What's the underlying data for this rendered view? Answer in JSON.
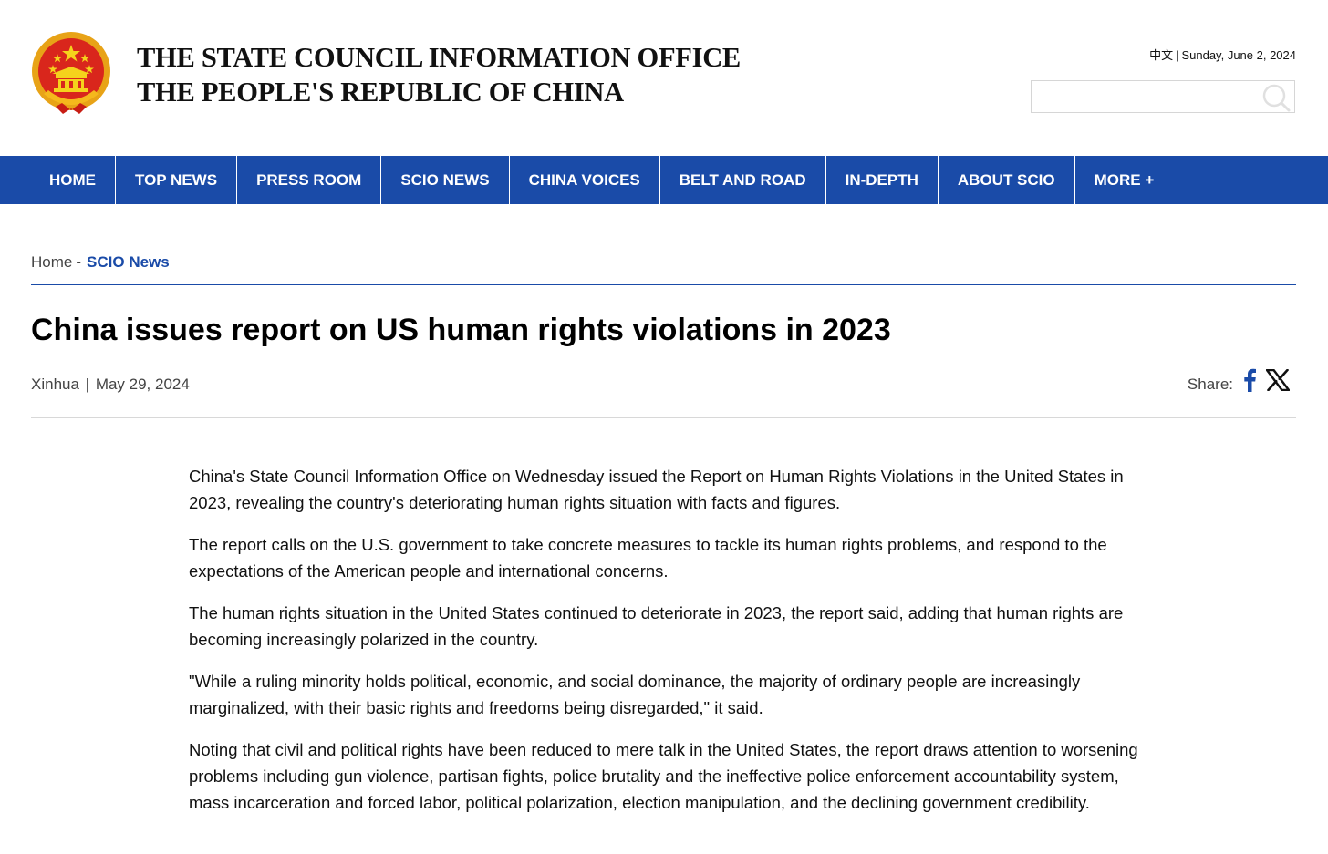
{
  "header": {
    "title_line1": "THE STATE COUNCIL INFORMATION OFFICE",
    "title_line2": "THE PEOPLE'S REPUBLIC OF CHINA",
    "language_link": "中文",
    "date": "Sunday, June 2, 2024",
    "search_placeholder": "",
    "emblem_icon": "national-emblem-icon",
    "search_icon": "magnifier-icon"
  },
  "nav": {
    "items": [
      {
        "label": "HOME"
      },
      {
        "label": "TOP NEWS"
      },
      {
        "label": "PRESS ROOM"
      },
      {
        "label": "SCIO NEWS"
      },
      {
        "label": "CHINA VOICES"
      },
      {
        "label": "BELT AND ROAD"
      },
      {
        "label": "IN-DEPTH"
      },
      {
        "label": "ABOUT SCIO"
      },
      {
        "label": "MORE +"
      }
    ]
  },
  "breadcrumb": {
    "home": "Home",
    "separator": "-",
    "current": "SCIO News"
  },
  "article": {
    "headline": "China issues report on US human rights violations in 2023",
    "source": "Xinhua",
    "date": "May 29, 2024",
    "share_label": "Share:",
    "paragraphs": [
      "China's State Council Information Office on Wednesday issued the Report on Human Rights Violations in the United States in 2023, revealing the country's deteriorating human rights situation with facts and figures.",
      "The report calls on the U.S. government to take concrete measures to tackle its human rights problems, and respond to the expectations of the American people and international concerns.",
      "The human rights situation in the United States continued to deteriorate in 2023, the report said, adding that human rights are becoming increasingly polarized in the country.",
      "\"While a ruling minority holds political, economic, and social dominance, the majority of ordinary people are increasingly marginalized, with their basic rights and freedoms being disregarded,\" it said.",
      "Noting that civil and political rights have been reduced to mere talk in the United States, the report draws attention to worsening problems including gun violence, partisan fights, police brutality and the ineffective police enforcement accountability system, mass incarceration and forced labor, political polarization, election manipulation, and the declining government credibility."
    ]
  },
  "colors": {
    "brand_blue": "#1a4ba8",
    "emblem_red": "#d9261c",
    "emblem_gold": "#f5b81c"
  }
}
